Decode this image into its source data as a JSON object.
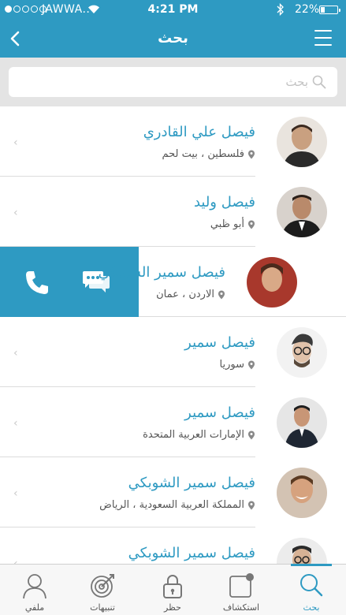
{
  "status_bar": {
    "carrier": "JAWWA..",
    "time": "4:21 PM",
    "battery": "22%"
  },
  "header": {
    "title": "بحث"
  },
  "search": {
    "placeholder": "بحث"
  },
  "contacts": [
    {
      "name": "فيصل علي القادري",
      "location": "فلسطين ، بيت لحم"
    },
    {
      "name": "فيصل وليد",
      "location": "أبو ظبي"
    },
    {
      "name": "فيصل سمير الشوبكي",
      "location": "الاردن ، عمان",
      "swiped": true
    },
    {
      "name": "فيصل سمير",
      "location": "سوريا"
    },
    {
      "name": "فيصل سمير",
      "location": "الإمارات العربية المتحدة"
    },
    {
      "name": "فيصل سمير الشوبكي",
      "location": "المملكة العربية السعودية ، الرياض"
    },
    {
      "name": "فيصل سمير الشوبكي",
      "location": ""
    }
  ],
  "tabs": [
    {
      "label": "بحث",
      "icon": "search-icon",
      "active": true
    },
    {
      "label": "استكشاف",
      "icon": "explore-icon"
    },
    {
      "label": "حظر",
      "icon": "lock-icon"
    },
    {
      "label": "تنبيهات",
      "icon": "target-icon"
    },
    {
      "label": "ملفي",
      "icon": "user-icon"
    }
  ],
  "colors": {
    "accent": "#2e9ac2",
    "background": "#e4e4e4"
  }
}
